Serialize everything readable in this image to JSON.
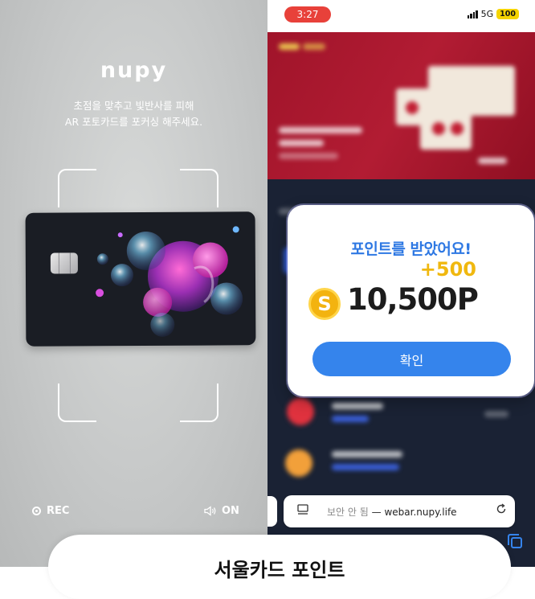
{
  "left_screen": {
    "logo": "nupy",
    "instruction_line1": "초점을 맞추고 빛반사를 피해",
    "instruction_line2": "AR 포토카드를 포커싱 해주세요.",
    "rec_label": "REC",
    "sound_label": "ON",
    "rec_icon": "record-icon",
    "sound_icon": "speaker-icon"
  },
  "status_bar": {
    "time": "3:27",
    "network": "5G",
    "battery": "100"
  },
  "modal": {
    "title": "포인트를 받았어요!",
    "plus": "+500",
    "points": "10,500P",
    "coin_symbol": "S",
    "confirm_label": "확인"
  },
  "url_bar": {
    "security": "보안 안 됨",
    "separator": " — ",
    "domain": "webar.nupy.life",
    "reload_icon": "reload-icon",
    "reader_icon": "reader-icon"
  },
  "bottom_sheet": {
    "title": "서울카드 포인트"
  },
  "colors": {
    "accent_blue": "#3584ec",
    "coin_gold": "#f3b30f",
    "banner_red": "#b21c33",
    "time_pill": "#e8413a"
  }
}
